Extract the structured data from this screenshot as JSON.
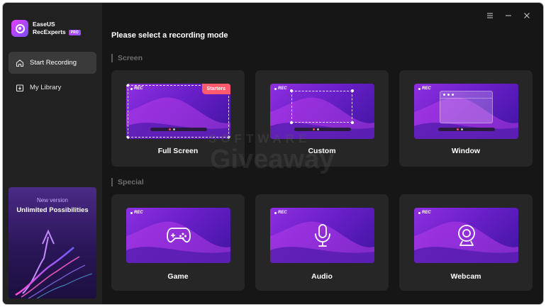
{
  "app": {
    "name_line1": "EaseUS",
    "name_line2": "RecExperts",
    "badge": "PRO"
  },
  "sidebar": {
    "items": [
      {
        "label": "Start Recording",
        "icon": "home-icon",
        "active": true
      },
      {
        "label": "My Library",
        "icon": "library-icon",
        "active": false
      }
    ],
    "promo": {
      "line1": "New version",
      "line2": "Unlimited Possibilities"
    }
  },
  "window_controls": [
    "menu-icon",
    "minimize-icon",
    "close-icon"
  ],
  "main": {
    "heading": "Please select a recording mode",
    "sections": [
      {
        "label": "Screen",
        "cards": [
          {
            "title": "Full Screen",
            "rec": "REC",
            "badge": "Starters"
          },
          {
            "title": "Custom",
            "rec": "REC"
          },
          {
            "title": "Window",
            "rec": "REC"
          }
        ]
      },
      {
        "label": "Special",
        "cards": [
          {
            "title": "Game",
            "rec": "REC",
            "icon": "gamepad-icon"
          },
          {
            "title": "Audio",
            "rec": "REC",
            "icon": "microphone-icon"
          },
          {
            "title": "Webcam",
            "rec": "REC",
            "icon": "webcam-icon"
          }
        ]
      }
    ]
  },
  "watermark": {
    "line1": "SOFTWARE",
    "line2": "Giveaway"
  },
  "colors": {
    "accent_purple": "#8e2fe0",
    "starters_badge": "#ff5a6e",
    "background": "#161616",
    "sidebar": "#212121",
    "card": "#262626"
  }
}
